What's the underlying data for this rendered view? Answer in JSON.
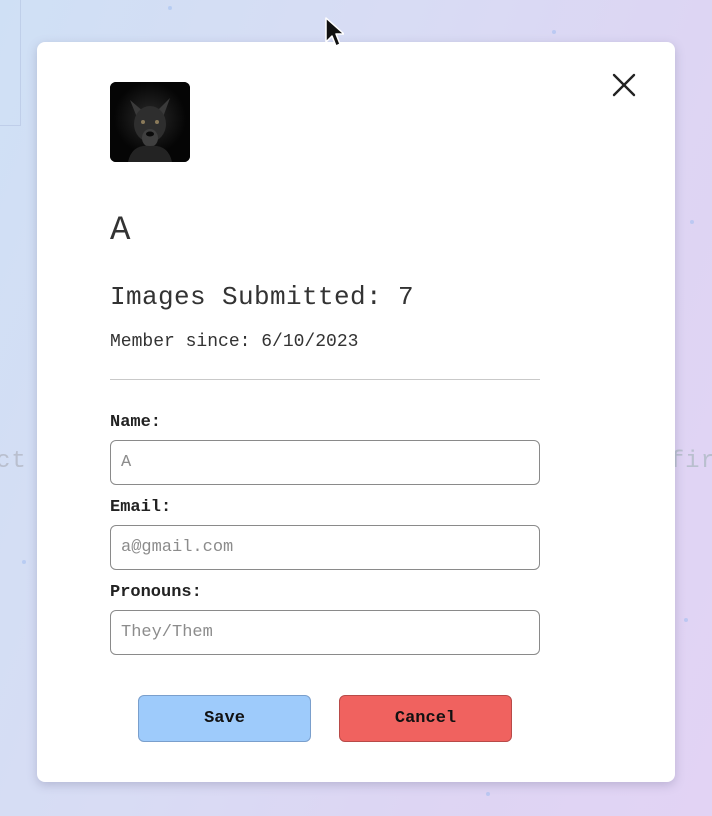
{
  "background": {
    "left_fragment": "ct",
    "right_fragment": "fir"
  },
  "profile": {
    "avatar_alt": "black-dog-photo",
    "username": "A",
    "images_submitted": "Images Submitted: 7",
    "member_since": "Member since: 6/10/2023"
  },
  "form": {
    "name_label": "Name:",
    "name_placeholder": "A",
    "email_label": "Email:",
    "email_placeholder": "a@gmail.com",
    "pronouns_label": "Pronouns:",
    "pronouns_placeholder": "They/Them"
  },
  "actions": {
    "save_label": "Save",
    "cancel_label": "Cancel"
  },
  "colors": {
    "save_button": "#9ecbfb",
    "cancel_button": "#f0625f",
    "modal_background": "#ffffff"
  },
  "icons": {
    "close": "close-icon",
    "cursor": "mouse-pointer-icon"
  }
}
